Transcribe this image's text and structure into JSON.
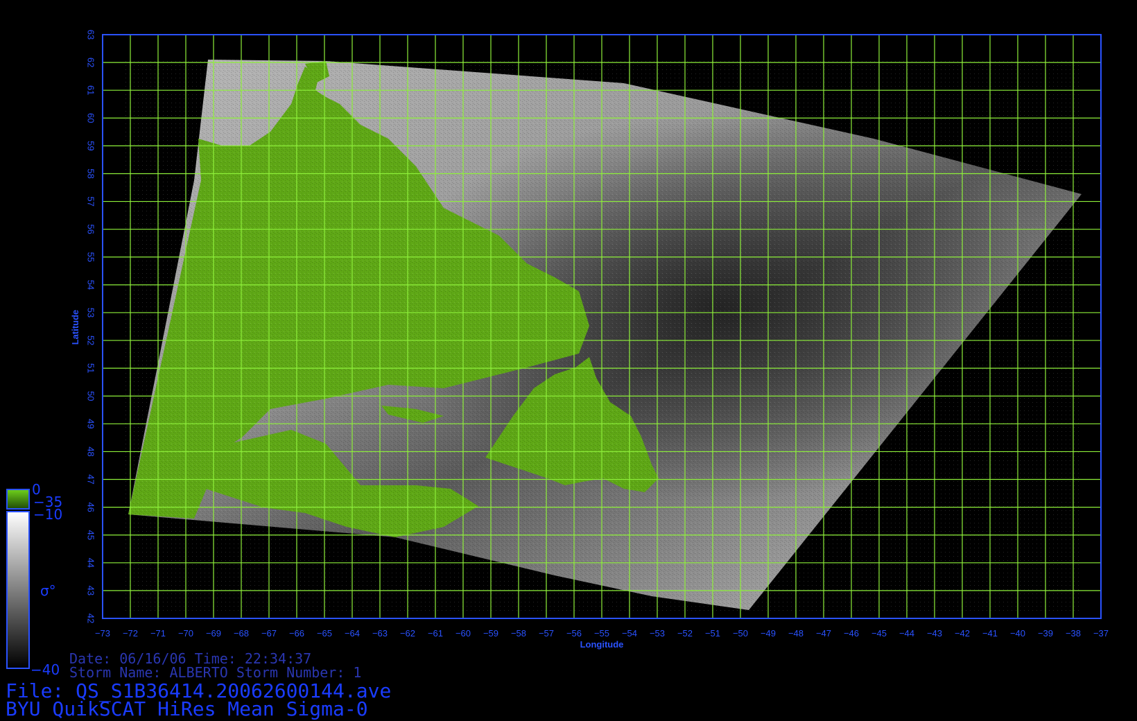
{
  "map": {
    "xlabel": "Longitude",
    "ylabel": "Latitude",
    "lon_range": [
      -73,
      -37
    ],
    "lat_range": [
      42,
      63
    ],
    "lon_ticks": [
      -73,
      -72,
      -71,
      -70,
      -69,
      -68,
      -67,
      -66,
      -65,
      -64,
      -63,
      -62,
      -61,
      -60,
      -59,
      -58,
      -57,
      -56,
      -55,
      -54,
      -53,
      -52,
      -51,
      -50,
      -49,
      -48,
      -47,
      -46,
      -45,
      -44,
      -43,
      -42,
      -41,
      -40,
      -39,
      -38,
      -37
    ],
    "lat_ticks": [
      42,
      43,
      44,
      45,
      46,
      47,
      48,
      49,
      50,
      51,
      52,
      53,
      54,
      55,
      56,
      57,
      58,
      59,
      60,
      61,
      62,
      63
    ],
    "grid": true,
    "colors": {
      "frame": "#2a52ff",
      "grid": "#8ef03a",
      "land": "#5fa816",
      "ocean_light": "#bdbdbd",
      "ocean_dark": "#303030"
    }
  },
  "colorbar": {
    "land_top": "0",
    "land_bottom": "−35",
    "sea_top": "−10",
    "symbol": "σ°",
    "sea_bottom": "−40"
  },
  "info": {
    "date_line": "Date: 06/16/06   Time: 22:34:37",
    "storm_line": "Storm Name: ALBERTO   Storm Number: 1",
    "file_line": "File: QS_S1B36414.20062600144.ave",
    "title_line": "BYU QuikSCAT HiRes Mean Sigma-0"
  }
}
